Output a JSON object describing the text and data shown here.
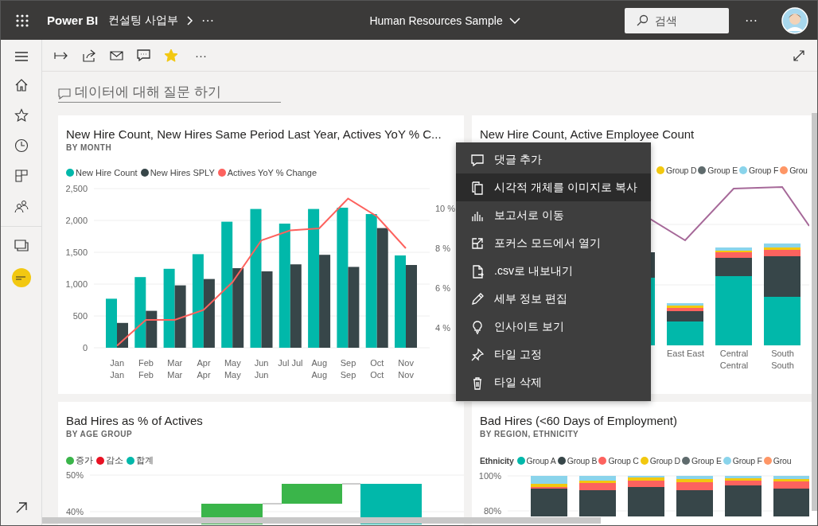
{
  "app_bar": {
    "brand": "Power BI",
    "breadcrumb": "컨설팅 사업부",
    "breadcrumb_more": "···",
    "report_title": "Human Resources Sample",
    "search": {
      "placeholder": "검색"
    },
    "more": "···"
  },
  "toolbar": {
    "favorite": true,
    "more": "···"
  },
  "qna": {
    "placeholder": "데이터에 대해 질문 하기"
  },
  "hire_tile": {
    "title": "New Hire Count, New Hires Same Period Last Year, Actives YoY % C...",
    "subtitle": "BY MONTH",
    "chart_data": {
      "type": "bar",
      "categories": [
        "Jan\nJan",
        "Feb\nFeb",
        "Mar\nMar",
        "Apr\nApr",
        "May\nMay",
        "Jun\nJun",
        "Jul Jul",
        "Aug\nAug",
        "Sep\nSep",
        "Oct\nOct",
        "Nov\nNov"
      ],
      "series": [
        {
          "name": "New Hire Count",
          "color": "#01b8aa",
          "values": [
            770,
            1110,
            1240,
            1470,
            1980,
            2180,
            1950,
            2180,
            2200,
            2100,
            1450
          ]
        },
        {
          "name": "New Hires SPLY",
          "color": "#374649",
          "values": [
            390,
            580,
            980,
            1080,
            1250,
            1200,
            1310,
            1460,
            1270,
            1880,
            1300
          ]
        },
        {
          "name": "Actives YoY % Change",
          "color": "#fd625e",
          "type": "line",
          "axis": "y2",
          "values": [
            3.1,
            4.4,
            4.4,
            4.9,
            6.3,
            8.4,
            8.9,
            9.0,
            10.5,
            9.6,
            8.0
          ]
        }
      ],
      "ylim": [
        0,
        2500
      ],
      "y2lim": [
        3,
        11
      ],
      "grid": true,
      "legend": true,
      "yticks": [
        {
          "value": 0,
          "label": "0"
        },
        {
          "value": 500,
          "label": "500"
        },
        {
          "value": 1000,
          "label": "1,000"
        },
        {
          "value": 1500,
          "label": "1,500"
        },
        {
          "value": 2000,
          "label": "2,000"
        },
        {
          "value": 2500,
          "label": "2,500"
        }
      ],
      "y2ticks": [
        {
          "value": 4,
          "label": "4 %"
        },
        {
          "value": 6,
          "label": "6 %"
        },
        {
          "value": 8,
          "label": "8 %"
        },
        {
          "value": 10,
          "label": "10 %"
        }
      ]
    }
  },
  "region_tile": {
    "title": "New Hire Count, Active Employee Count",
    "legend": [
      {
        "label": "Group D",
        "color": "#f2c80f"
      },
      {
        "label": "Group E",
        "color": "#5f6b6d"
      },
      {
        "label": "Group F",
        "color": "#8ad4eb"
      },
      {
        "label": "Grou",
        "color": "#fe9666"
      }
    ],
    "x_labels": [
      "East East",
      "Central\nCentral",
      "South\nSouth"
    ]
  },
  "bad_age_tile": {
    "title": "Bad Hires as % of Actives",
    "subtitle": "BY AGE GROUP",
    "legend": [
      {
        "label": "증가",
        "color": "#3ab54a"
      },
      {
        "label": "감소",
        "color": "#e81123"
      },
      {
        "label": "합계",
        "color": "#01b8aa"
      }
    ],
    "ticks": [
      "50%",
      "40%"
    ]
  },
  "bad_region_tile": {
    "title": "Bad Hires (<60 Days of Employment)",
    "subtitle": "BY REGION, ETHNICITY",
    "legend_title": "Ethnicity",
    "legend": [
      {
        "label": "Group A",
        "color": "#01b8aa"
      },
      {
        "label": "Group B",
        "color": "#374649"
      },
      {
        "label": "Group C",
        "color": "#fd625e"
      },
      {
        "label": "Group D",
        "color": "#f2c80f"
      },
      {
        "label": "Group E",
        "color": "#5f6b6d"
      },
      {
        "label": "Group F",
        "color": "#8ad4eb"
      },
      {
        "label": "Grou",
        "color": "#fe9666"
      }
    ],
    "ticks": [
      "100%",
      "80%"
    ]
  },
  "context_menu": {
    "items": [
      {
        "label": "댓글 추가",
        "selected": false
      },
      {
        "label": "시각적 개체를 이미지로 복사",
        "selected": true
      },
      {
        "label": "보고서로 이동",
        "selected": false
      },
      {
        "label": "포커스 모드에서 열기",
        "selected": false
      },
      {
        "label": ".csv로 내보내기",
        "selected": false
      },
      {
        "label": "세부 정보 편집",
        "selected": false
      },
      {
        "label": "인사이트 보기",
        "selected": false
      },
      {
        "label": "타일 고정",
        "selected": false
      },
      {
        "label": "타일 삭제",
        "selected": false
      }
    ]
  }
}
